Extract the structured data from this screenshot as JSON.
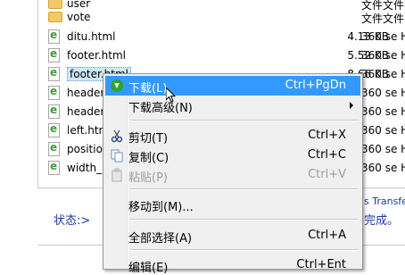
{
  "files": [
    {
      "name": "user",
      "size": "",
      "type": "文件文件",
      "icon": "folder-icon"
    },
    {
      "name": "vote",
      "size": "",
      "type": "文件文件",
      "icon": "folder-icon"
    },
    {
      "name": "ditu.html",
      "size": "4.13 KB",
      "type": "360 se H",
      "icon": "html-file-icon"
    },
    {
      "name": "footer.html",
      "size": "5.52 KB",
      "type": "360 se H",
      "icon": "html-file-icon"
    },
    {
      "name": "footer.html",
      "size": "8.66 KB",
      "type": "360 se H",
      "icon": "html-file-icon"
    },
    {
      "name": "header",
      "size": "",
      "type": "360 se H",
      "icon": "html-file-icon"
    },
    {
      "name": "header",
      "size": "",
      "type": "360 se H",
      "icon": "html-file-icon"
    },
    {
      "name": "left.htm",
      "size": "",
      "type": "360 se H",
      "icon": "html-file-icon"
    },
    {
      "name": "position",
      "size": "",
      "type": "360 se H",
      "icon": "html-file-icon"
    },
    {
      "name": "width_r",
      "size": "",
      "type": "360 se H",
      "icon": "html-file-icon"
    }
  ],
  "status": {
    "label": "状态:>",
    "right_top": "s Transfe",
    "right_bottom": "完成。"
  },
  "menu": {
    "download": {
      "label": "下载(L)",
      "shortcut": "Ctrl+PgDn"
    },
    "download_advanced": {
      "label": "下载高级(N)"
    },
    "cut": {
      "label": "剪切(T)",
      "shortcut": "Ctrl+X"
    },
    "copy": {
      "label": "复制(C)",
      "shortcut": "Ctrl+C"
    },
    "paste": {
      "label": "粘贴(P)",
      "shortcut": "Ctrl+V"
    },
    "move_to": {
      "label": "移动到(M)..."
    },
    "select_all": {
      "label": "全部选择(A)",
      "shortcut": "Ctrl+A"
    },
    "edit": {
      "label": "编辑(E)",
      "shortcut": "Ctrl+Ent"
    }
  }
}
